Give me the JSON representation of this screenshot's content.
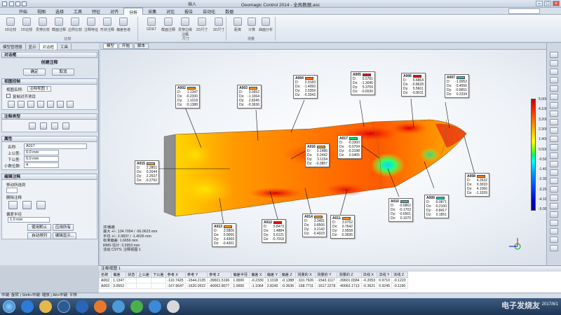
{
  "window": {
    "title": "Geomagic Control 2014 - 全局数据.asc",
    "top_tag": "插入"
  },
  "menu": [
    "开始",
    "视图",
    "选择",
    "工具",
    "特征",
    "对齐",
    "分析",
    "采集",
    "对比",
    "报告",
    "自动化",
    "数据"
  ],
  "ribbon": {
    "left_group": [
      "3D比较",
      "2D比较",
      "贯穿比较",
      "截面注释",
      "边界比较",
      "注释特征",
      "形状注释",
      "偏差色谱"
    ],
    "left_group_label": "比较",
    "mid_group": [
      "GD&T",
      "截面注释",
      "贯穿边缘注释",
      "2D尺寸",
      "3D尺寸"
    ],
    "mid_group_label": "尺寸",
    "right_group": [
      "距离",
      "计算",
      "曲面分析"
    ],
    "right_group_label": "测量"
  },
  "left_tabs": [
    "模型管理器",
    "显示",
    "对话框",
    "工具"
  ],
  "panel": {
    "title": "对话框",
    "section_title": "创建注释",
    "ok_label": "确定",
    "cancel_label": "取消",
    "view_section": "视图控制",
    "view_label": "视图名称:",
    "view_value": "注释视图 1",
    "copy_check_label": "复制对齐项目",
    "type_section": "注释类型",
    "attr_section": "属性",
    "name_label": "名称:",
    "name_value": "A017",
    "upper_label": "上公差:",
    "upper_value": "0.0 mm",
    "lower_label": "下公差:",
    "lower_value": "0.0 mm",
    "decimal_label": "小数位数:",
    "decimal_value": "4",
    "edit_section": "编辑注释",
    "move_label": "移动所选到",
    "move_value": "",
    "delete_label": "删除注释",
    "deviation_label": "偏差半径",
    "radius_value": "1.0 mm",
    "apply_default": "使用默认",
    "apply_all": "应用所有",
    "auto_arrange": "自动排列",
    "edit_display": "编辑显示..."
  },
  "view_tabs": [
    "模型",
    "开始",
    "脚本"
  ],
  "callouts": [
    {
      "id": "A002",
      "color": "#ff8c1a",
      "rows": [
        [
          "D:",
          "1.1347"
        ],
        [
          "Dx:",
          "-0.2330"
        ],
        [
          "Dy:",
          "1.1018"
        ],
        [
          "Dz:",
          "-0.1388"
        ]
      ]
    },
    {
      "id": "A003",
      "color": "#ff9a1a",
      "rows": [
        [
          "D:",
          "3.0552"
        ],
        [
          "Dx:",
          "-1.1064"
        ],
        [
          "Dy:",
          "2.8245"
        ],
        [
          "Dz:",
          "-0.3636"
        ]
      ]
    },
    {
      "id": "A004",
      "color": "#ff6a1a",
      "rows": [
        [
          "D:",
          "2.9183"
        ],
        [
          "Dx:",
          "-1.4050"
        ],
        [
          "Dy:",
          "2.5359"
        ],
        [
          "Dz:",
          "-0.3343"
        ]
      ]
    },
    {
      "id": "A005",
      "color": "#e01010",
      "rows": [
        [
          "D:",
          "5.5781"
        ],
        [
          "Dx:",
          "-1.3045"
        ],
        [
          "Dy:",
          "5.3709"
        ],
        [
          "Dz:",
          "-0.6530"
        ]
      ]
    },
    {
      "id": "A006",
      "color": "#e01010",
      "rows": [
        [
          "D:",
          "5.6864"
        ],
        [
          "Dx:",
          "-0.8628"
        ],
        [
          "Dy:",
          "5.5601"
        ],
        [
          "Dz:",
          "-0.8011"
        ]
      ]
    },
    {
      "id": "A007",
      "color": "#10c8d8",
      "rows": [
        [
          "D:",
          "-1.0052"
        ],
        [
          "Dx:",
          "0.4556"
        ],
        [
          "Dy:",
          "-0.8651"
        ],
        [
          "Dz:",
          "0.2334"
        ]
      ]
    },
    {
      "id": "A008",
      "color": "#ff7a1a",
      "rows": [
        [
          "D:",
          "4.2632"
        ],
        [
          "Dx:",
          "0.3033"
        ],
        [
          "Dy:",
          "4.1066"
        ],
        [
          "Dz:",
          "-1.1039"
        ]
      ]
    },
    {
      "id": "A009",
      "color": "#10c8d8",
      "rows": [
        [
          "D:",
          "-0.0871"
        ],
        [
          "Dx:",
          "-0.2100"
        ],
        [
          "Dy:",
          "-0.8417"
        ],
        [
          "Dz:",
          "0.1851"
        ]
      ]
    },
    {
      "id": "A010",
      "color": "#10c8d8",
      "rows": [
        [
          "D:",
          "-0.6862"
        ],
        [
          "Dx:",
          "-0.1703"
        ],
        [
          "Dy:",
          "-0.6561"
        ],
        [
          "Dz:",
          "0.1070"
        ]
      ]
    },
    {
      "id": "A011",
      "color": "#ff9a1a",
      "rows": [
        [
          "D:",
          "3.0752"
        ],
        [
          "Dx:",
          "0.7642"
        ],
        [
          "Dy:",
          "2.9558"
        ],
        [
          "Dz:",
          "-0.3695"
        ]
      ]
    },
    {
      "id": "A012",
      "color": "#e01010",
      "rows": [
        [
          "D:",
          "5.8473"
        ],
        [
          "Dx:",
          "1.4884"
        ],
        [
          "Dy:",
          "5.6121"
        ],
        [
          "Dz:",
          "-0.7018"
        ]
      ]
    },
    {
      "id": "A013",
      "color": "#ff9a1a",
      "rows": [
        [
          "D:",
          "3.5806"
        ],
        [
          "Dx:",
          "0.9066"
        ],
        [
          "Dy:",
          "3.4369"
        ],
        [
          "Dz:",
          "-0.4301"
        ]
      ]
    },
    {
      "id": "A014",
      "color": "#ff9a1a",
      "rows": [
        [
          "D:",
          "3.3491"
        ],
        [
          "Dx:",
          "0.8506"
        ],
        [
          "Dy:",
          "3.2142"
        ],
        [
          "Dz:",
          "-0.4023"
        ]
      ]
    },
    {
      "id": "A015",
      "color": "#ffb01a",
      "rows": [
        [
          "D:",
          "2.2801"
        ],
        [
          "Dx:",
          "0.2044"
        ],
        [
          "Dy:",
          "2.2537"
        ],
        [
          "Dz:",
          "-0.2792"
        ]
      ]
    },
    {
      "id": "A016",
      "color": "#ff9a1a",
      "rows": [
        [
          "D:",
          "3.1486"
        ],
        [
          "Dx:",
          "0.2442"
        ],
        [
          "Dy:",
          "3.1154"
        ],
        [
          "Dz:",
          "-0.3857"
        ]
      ]
    },
    {
      "id": "A017",
      "color": "#10e060",
      "rows": [
        [
          "D:",
          "-0.3300"
        ],
        [
          "Dx:",
          "-0.0704"
        ],
        [
          "Dy:",
          "-0.3198"
        ],
        [
          "Dz:",
          "0.0405"
        ]
      ]
    }
  ],
  "scale": {
    "ticks": [
      "5.0000",
      "4.1000",
      "3.2000",
      "2.3000",
      "1.4000",
      "0.5000",
      "-0.5000",
      "-1.4000",
      "-2.3000",
      "-3.2000",
      "-4.1000",
      "-5.0000"
    ]
  },
  "stats": {
    "title": "3D偏差",
    "max": "最大 +/-: 134.7054 / -56.0623 mm",
    "avg": "平均 +/-: 2.9837 / -1.4026 mm",
    "std": "标准偏差: 1.6656 mm",
    "rms": "RMS 估计: 3.3953 mm",
    "csys": "活动 CSYS: 注释视图 1"
  },
  "table": {
    "title": "注释视图 1",
    "headers": [
      "名称",
      "偏差",
      "状态",
      "上公差",
      "下公差",
      "参考 X",
      "参考 Y",
      "参考 Z",
      "偏差半径",
      "偏差 X",
      "偏差 Y",
      "偏差 Z",
      "测量的 X",
      "测量的 Y",
      "测量的 Z",
      "法线 X",
      "法线 Y",
      "法线 Z"
    ],
    "rows": [
      [
        "A002",
        "1.1347",
        "",
        "",
        "",
        "-110.7425",
        "-1544.2135",
        "-39601.5196",
        "1.0000",
        "-0.2330",
        "1.1018",
        "-0.1388",
        "-110.7926",
        "-1543.1117",
        "-39601.6584",
        "-0.2053",
        "0.9710",
        "-0.1223"
      ],
      [
        "A003",
        "3.0552",
        "",
        "",
        "",
        "-167.6647",
        "-1620.0522",
        "-40062.8077",
        "1.0000",
        "-1.1064",
        "2.8245",
        "-0.3636",
        "-168.7711",
        "-1617.2278",
        "-40063.1713",
        "-0.3621",
        "0.9245",
        "-0.1190"
      ]
    ]
  },
  "statusbar": "中键: 旋转 | Shift+中键: 缩放 | Alt+中键: 平移",
  "clock": {
    "time": "",
    "date": "2017/8/1"
  },
  "watermark": "电子发烧友"
}
